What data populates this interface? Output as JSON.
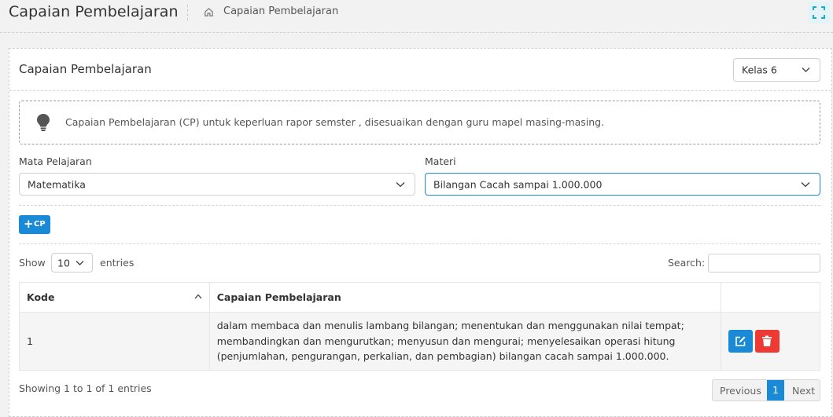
{
  "header": {
    "title": "Capaian Pembelajaran",
    "breadcrumb": "Capaian Pembelajaran"
  },
  "card": {
    "title": "Capaian Pembelajaran",
    "kelas_select": "Kelas 6",
    "alert": "Capaian Pembelajaran (CP) untuk keperluan rapor semster , disesuaikan dengan guru mapel masing-masing.",
    "mapel_label": "Mata Pelajaran",
    "mapel_value": "Matematika",
    "materi_label": "Materi",
    "materi_value": "Bilangan Cacah sampai 1.000.000",
    "add_button": "CP"
  },
  "table_controls": {
    "show": "Show",
    "length": "10",
    "entries": "entries",
    "search": "Search:"
  },
  "table": {
    "columns": [
      "Kode",
      "Capaian Pembelajaran"
    ],
    "rows": [
      {
        "kode": "1",
        "capaian": "dalam membaca dan menulis lambang bilangan; menentukan dan menggunakan nilai tempat; membandingkan dan mengurutkan; menyusun dan mengurai; menyelesaikan operasi hitung (penjumlahan, pengurangan, perkalian, dan pembagian) bilangan cacah sampai 1.000.000."
      }
    ]
  },
  "footer": {
    "info": "Showing 1 to 1 of 1 entries",
    "previous": "Previous",
    "current_page": "1",
    "next": "Next"
  },
  "colors": {
    "primary": "#1a8ad6",
    "danger": "#ee3a33"
  }
}
